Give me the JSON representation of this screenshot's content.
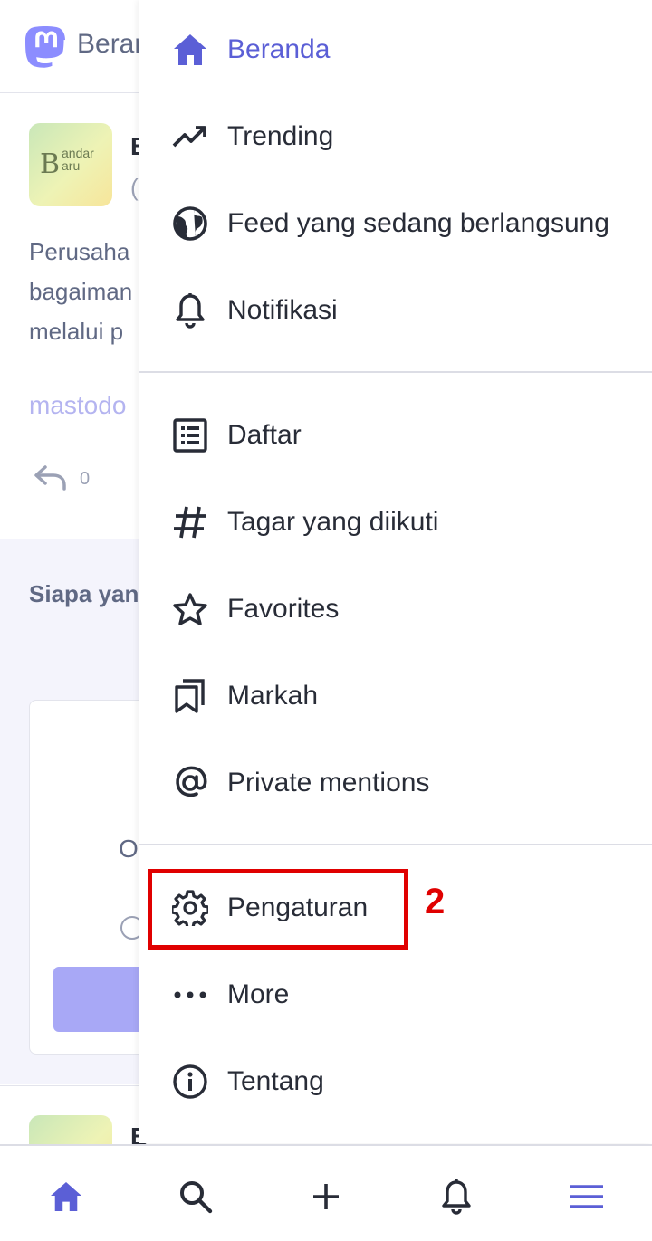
{
  "background": {
    "header_title": "Beranda",
    "post": {
      "avatar_text": "B",
      "avatar_sub": "andar aru",
      "name": "B",
      "handle": "(",
      "body_lines": [
        "Perusaha",
        "bagaiman",
        "melalui p"
      ],
      "link": "mastodo",
      "reply_count": "0"
    },
    "suggestions": {
      "title": "Siapa yang diikuti",
      "card_letter": "O"
    },
    "post2": {
      "name": "B"
    }
  },
  "menu": {
    "group1": [
      {
        "label": "Beranda",
        "icon": "home-icon",
        "active": true
      },
      {
        "label": "Trending",
        "icon": "trending-icon"
      },
      {
        "label": "Feed yang sedang berlangsung",
        "icon": "globe-icon"
      },
      {
        "label": "Notifikasi",
        "icon": "bell-icon"
      }
    ],
    "group2": [
      {
        "label": "Daftar",
        "icon": "list-icon"
      },
      {
        "label": "Tagar yang diikuti",
        "icon": "hashtag-icon"
      },
      {
        "label": "Favorites",
        "icon": "star-icon"
      },
      {
        "label": "Markah",
        "icon": "bookmark-icon"
      },
      {
        "label": "Private mentions",
        "icon": "at-icon"
      }
    ],
    "group3": [
      {
        "label": "Pengaturan",
        "icon": "gear-icon"
      },
      {
        "label": "More",
        "icon": "more-icon"
      },
      {
        "label": "Tentang",
        "icon": "info-icon"
      }
    ]
  },
  "annotation": {
    "step_number": "2"
  },
  "tabbar": {
    "tabs": [
      "home-icon",
      "search-icon",
      "compose-icon",
      "notifications-icon",
      "menu-icon"
    ]
  },
  "colors": {
    "accent": "#5b5fd6",
    "text": "#282c37",
    "muted": "#606984",
    "highlight": "#e00000"
  }
}
